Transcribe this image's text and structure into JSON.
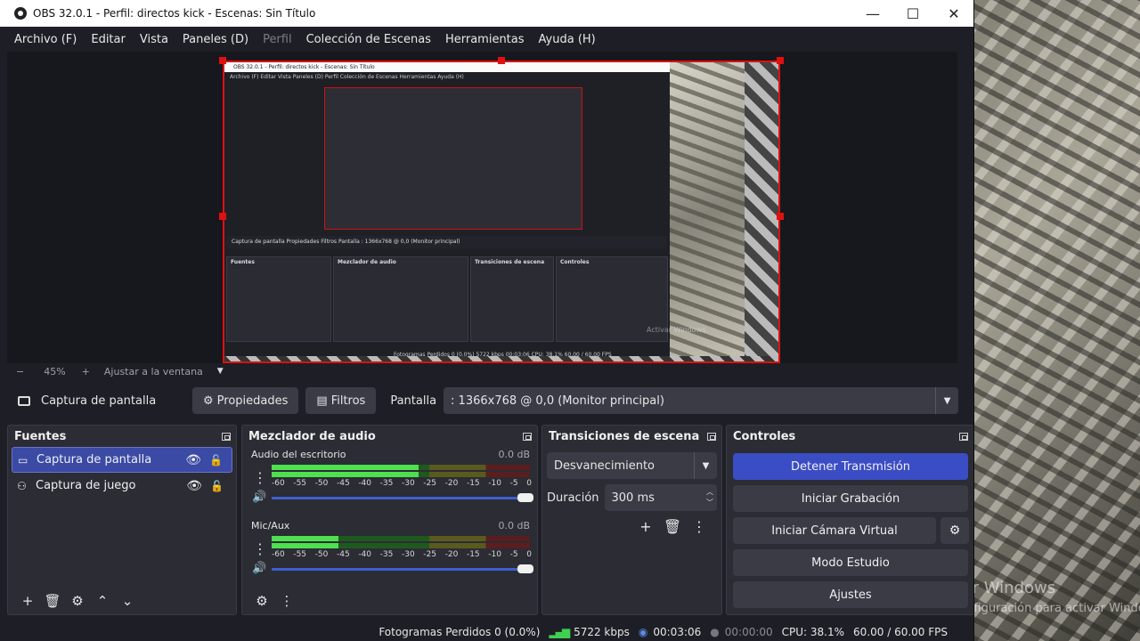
{
  "window": {
    "title": "OBS 32.0.1 - Perfil: directos kick - Escenas: Sin Título"
  },
  "menu": [
    "Archivo (F)",
    "Editar",
    "Vista",
    "Paneles (D)",
    "Perfil",
    "Colección de Escenas",
    "Herramientas",
    "Ayuda (H)"
  ],
  "zoom": {
    "minus": "−",
    "value": "45%",
    "plus": "+",
    "fit": "Ajustar a la ventana"
  },
  "source_toolbar": {
    "source_name": "Captura de pantalla",
    "properties_label": "Propiedades",
    "filters_label": "Filtros",
    "display_label": "Pantalla",
    "display_value": ": 1366x768 @ 0,0 (Monitor principal)"
  },
  "sources": {
    "title": "Fuentes",
    "items": [
      {
        "label": "Captura de pantalla",
        "icon": "monitor-icon"
      },
      {
        "label": "Captura de juego",
        "icon": "gamepad-icon"
      }
    ]
  },
  "mixer": {
    "title": "Mezclador de audio",
    "scale": [
      "-60",
      "-55",
      "-50",
      "-45",
      "-40",
      "-35",
      "-30",
      "-25",
      "-20",
      "-15",
      "-10",
      "-5",
      "0"
    ],
    "channels": [
      {
        "name": "Audio del escritorio",
        "db": "0.0 dB",
        "level": 0.57
      },
      {
        "name": "Mic/Aux",
        "db": "0.0 dB",
        "level": 0.26
      }
    ]
  },
  "transitions": {
    "title": "Transiciones de escena",
    "selected": "Desvanecimiento",
    "duration_label": "Duración",
    "duration_value": "300 ms"
  },
  "controls": {
    "title": "Controles",
    "stop_stream": "Detener Transmisión",
    "start_recording": "Iniciar Grabación",
    "start_virtual_cam": "Iniciar Cámara Virtual",
    "studio_mode": "Modo Estudio",
    "settings": "Ajustes"
  },
  "status": {
    "dropped_frames": "Fotogramas Perdidos 0 (0.0%)",
    "bitrate": "5722 kbps",
    "stream_time": "00:03:06",
    "rec_time": "00:00:00",
    "cpu": "CPU: 38.1%",
    "fps": "60.00 / 60.00 FPS"
  },
  "nested": {
    "title": "OBS 32.0.1 - Perfil: directos kick - Escenas: Sin Título",
    "menu": "Archivo (F)   Editar   Vista   Paneles (D)   Perfil   Colección de Escenas   Herramientas   Ayuda (H)",
    "info": "Captura de pantalla        Propiedades   Filtros   Pantalla   : 1366x768 @ 0,0 (Monitor principal)",
    "fuentes": "Fuentes",
    "mezclador": "Mezclador de audio",
    "transiciones": "Transiciones de escena",
    "controles": "Controles",
    "status": "Fotogramas Perdidos 0 (0.0%)   5722 kbps   00:03:06   CPU: 38.1%   60.00 / 60.00 FPS",
    "activate": "Activar Windows"
  },
  "desktop": {
    "activate_title": "Activar Windows",
    "activate_sub": "Ve a Configuración para activar Windows."
  }
}
